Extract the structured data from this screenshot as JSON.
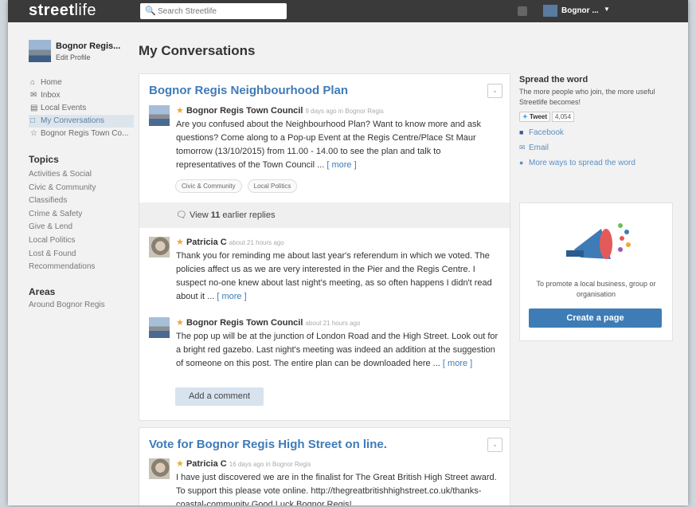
{
  "header": {
    "brand_bold": "street",
    "brand_light": "life",
    "search_placeholder": "Search Streetlife",
    "user_name": "Bognor ..."
  },
  "sidebar": {
    "profile_name": "Bognor Regis...",
    "profile_edit": "Edit Profile",
    "nav": [
      {
        "label": "Home",
        "icon": "home-icon"
      },
      {
        "label": "Inbox",
        "icon": "inbox-icon"
      },
      {
        "label": "Local Events",
        "icon": "calendar-icon"
      },
      {
        "label": "My Conversations",
        "icon": "bookmark-icon"
      },
      {
        "label": "Bognor Regis Town Co...",
        "icon": "star-icon"
      }
    ],
    "topics_heading": "Topics",
    "topics": [
      "Activities & Social",
      "Civic & Community",
      "Classifieds",
      "Crime & Safety",
      "Give & Lend",
      "Local Politics",
      "Lost & Found",
      "Recommendations"
    ],
    "areas_heading": "Areas",
    "areas": [
      "Around Bognor Regis"
    ]
  },
  "main": {
    "title": "My Conversations",
    "card1": {
      "title": "Bognor Regis Neighbourhood Plan",
      "post1": {
        "author": "Bognor Regis Town Council",
        "meta": "9 days ago in Bognor Regis",
        "text": "Are you confused about the Neighbourhood Plan? Want to know more and ask questions? Come along to a Pop-up Event at the Regis Centre/Place St Maur tomorrow (13/10/2015) from 11.00 - 14.00 to see the plan and talk to representatives of the Town Council ... ",
        "more": "[ more ]"
      },
      "tags": [
        "Civic & Community",
        "Local Politics"
      ],
      "view_prefix": "View ",
      "view_count": "11",
      "view_suffix": " earlier replies",
      "post2": {
        "author": "Patricia C",
        "meta": "about 21 hours ago",
        "text": "Thank you for reminding me about last year's referendum in which we voted. The policies affect us as we are very interested in the Pier and the Regis Centre. I suspect no-one knew about last night's meeting, as so often happens I didn't read about it ... ",
        "more": "[ more ]"
      },
      "post3": {
        "author": "Bognor Regis Town Council",
        "meta": "about 21 hours ago",
        "text": "The pop up will be at the junction of London Road and the High Street. Look out for a bright red gazebo.  Last night's meeting was indeed an addition at the suggestion of someone on this post. The entire plan can be downloaded here ... ",
        "more": "[ more ]"
      },
      "add_comment": "Add a comment"
    },
    "card2": {
      "title": "Vote for Bognor Regis High Street on line.",
      "post1": {
        "author": "Patricia C",
        "meta": "16 days ago in Bognor Regis",
        "text": "I have just discovered we are in the finalist for The Great British High Street award. To support this please vote online. http://thegreatbritishhighstreet.co.uk/thanks-coastal-community Good Luck Bognor Regis!"
      }
    }
  },
  "right": {
    "heading": "Spread the word",
    "text": "The more people who join, the more useful Streetlife becomes!",
    "tweet_label": "Tweet",
    "tweet_count": "4,054",
    "facebook": "Facebook",
    "email": "Email",
    "more_ways": "More ways to spread the word",
    "promo_text": "To promote a local business, group or organisation",
    "create_page": "Create a page"
  },
  "colors": {
    "accent": "#3f7bb8",
    "button": "#3e7cb6",
    "topbar": "#3a3a3a",
    "star": "#f0a830"
  }
}
